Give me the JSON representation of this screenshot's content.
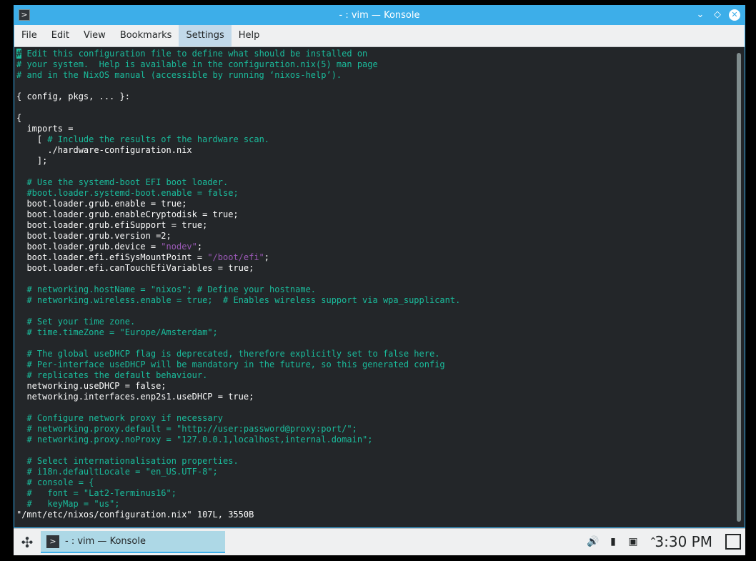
{
  "window": {
    "title": "- : vim — Konsole",
    "controls": {
      "minimize_icon": "⌄",
      "maximize_icon": "◇",
      "close_icon": "✕"
    }
  },
  "menubar": {
    "items": [
      "File",
      "Edit",
      "View",
      "Bookmarks",
      "Settings",
      "Help"
    ],
    "active": "Settings"
  },
  "terminal": {
    "lines": [
      "# Edit this configuration file to define what should be installed on",
      "# your system.  Help is available in the configuration.nix(5) man page",
      "# and in the NixOS manual (accessible by running ‘nixos-help’).",
      "",
      "{ config, pkgs, ... }:",
      "",
      "{",
      "  imports =",
      "    [ # Include the results of the hardware scan.",
      "      ./hardware-configuration.nix",
      "    ];",
      "",
      "  # Use the systemd-boot EFI boot loader.",
      "  #boot.loader.systemd-boot.enable = false;",
      "  boot.loader.grub.enable = true;",
      "  boot.loader.grub.enableCryptodisk = true;",
      "  boot.loader.grub.efiSupport = true;",
      "  boot.loader.grub.version =2;",
      "  boot.loader.grub.device = \"nodev\";",
      "  boot.loader.efi.efiSysMountPoint = \"/boot/efi\";",
      "  boot.loader.efi.canTouchEfiVariables = true;",
      "",
      "  # networking.hostName = \"nixos\"; # Define your hostname.",
      "  # networking.wireless.enable = true;  # Enables wireless support via wpa_supplicant.",
      "",
      "  # Set your time zone.",
      "  # time.timeZone = \"Europe/Amsterdam\";",
      "",
      "  # The global useDHCP flag is deprecated, therefore explicitly set to false here.",
      "  # Per-interface useDHCP will be mandatory in the future, so this generated config",
      "  # replicates the default behaviour.",
      "  networking.useDHCP = false;",
      "  networking.interfaces.enp2s1.useDHCP = true;",
      "",
      "  # Configure network proxy if necessary",
      "  # networking.proxy.default = \"http://user:password@proxy:port/\";",
      "  # networking.proxy.noProxy = \"127.0.0.1,localhost,internal.domain\";",
      "",
      "  # Select internationalisation properties.",
      "  # i18n.defaultLocale = \"en_US.UTF-8\";",
      "  # console = {",
      "  #   font = \"Lat2-Terminus16\";",
      "  #   keyMap = \"us\";"
    ],
    "status_line": "\"/mnt/etc/nixos/configuration.nix\" 107L, 3550B"
  },
  "taskbar": {
    "task_label": "- : vim — Konsole",
    "tray_icons": [
      "volume-icon",
      "usb-icon",
      "network-icon",
      "chevron-up-icon"
    ],
    "clock": "3:30 PM"
  },
  "colors": {
    "comment": "#1abc9c",
    "string": "#9b59b6",
    "foreground": "#fcfcfc",
    "background": "#232629",
    "accent": "#3daee9"
  }
}
